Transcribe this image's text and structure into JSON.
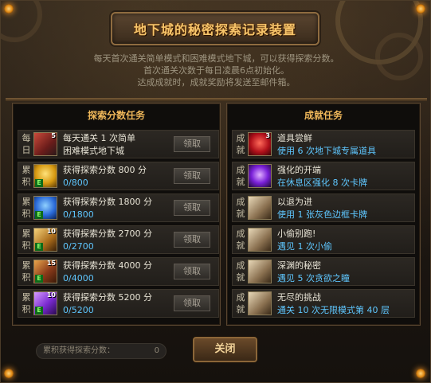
{
  "title": "地下城的秘密探索记录装置",
  "info_lines": [
    "每天首次通关简单模式和困难模式地下城，可以获得探索分数。",
    "首次通关次数于每日凌晨6点初始化。",
    "达成成就时，成就奖励将发送至邮件箱。"
  ],
  "left_panel": {
    "header": "探索分数任务",
    "rows": [
      {
        "tag": "每日",
        "line1": "每天通关 1 次简单",
        "line2": "困难模式地下城",
        "button": "领取",
        "icon": "cleaver-icon",
        "icon_num": "5"
      },
      {
        "tag": "累积",
        "line1": "获得探索分数 800 分",
        "line2": "0/800",
        "button": "领取",
        "icon": "gold-pot-icon",
        "icon_num": ""
      },
      {
        "tag": "累积",
        "line1": "获得探索分数 1800 分",
        "line2": "0/1800",
        "button": "领取",
        "icon": "blue-gift-icon",
        "icon_num": ""
      },
      {
        "tag": "累积",
        "line1": "获得探索分数 2700 分",
        "line2": "0/2700",
        "button": "领取",
        "icon": "card-icon",
        "icon_num": "10"
      },
      {
        "tag": "累积",
        "line1": "获得探索分数 4000 分",
        "line2": "0/4000",
        "button": "领取",
        "icon": "scroll-icon",
        "icon_num": "15"
      },
      {
        "tag": "累积",
        "line1": "获得探索分数 5200 分",
        "line2": "0/5200",
        "button": "领取",
        "icon": "purple-ticket-icon",
        "icon_num": "10"
      }
    ]
  },
  "right_panel": {
    "header": "成就任务",
    "rows": [
      {
        "tag": "成就",
        "line1": "道具尝鲜",
        "line2": "使用 6 次地下城专属道具",
        "icon": "red-gem-icon",
        "icon_num": "3"
      },
      {
        "tag": "成就",
        "line1": "强化的开端",
        "line2": "在休息区强化 8 次卡牌",
        "icon": "purple-orb-icon",
        "icon_num": ""
      },
      {
        "tag": "成就",
        "line1": "以退为进",
        "line2": "使用 1 张灰色边框卡牌",
        "icon": "hammer-icon",
        "icon_num": ""
      },
      {
        "tag": "成就",
        "line1": "小偷别跑!",
        "line2": "遇见 1 次小偷",
        "icon": "hammer-icon",
        "icon_num": ""
      },
      {
        "tag": "成就",
        "line1": "深渊的秘密",
        "line2": "遇见 5 次贪欲之瞳",
        "icon": "hammer-icon",
        "icon_num": ""
      },
      {
        "tag": "成就",
        "line1": "无尽的挑战",
        "line2": "通关 10 次无限模式第 40 层",
        "icon": "hammer-icon",
        "icon_num": ""
      }
    ]
  },
  "footer": {
    "score_label": "累积获得探索分数：",
    "score_value": "0",
    "close_label": "关闭"
  },
  "colors": {
    "accent": "#f0b85a",
    "progress": "#5fc7ff",
    "bg": "#1c1611"
  }
}
